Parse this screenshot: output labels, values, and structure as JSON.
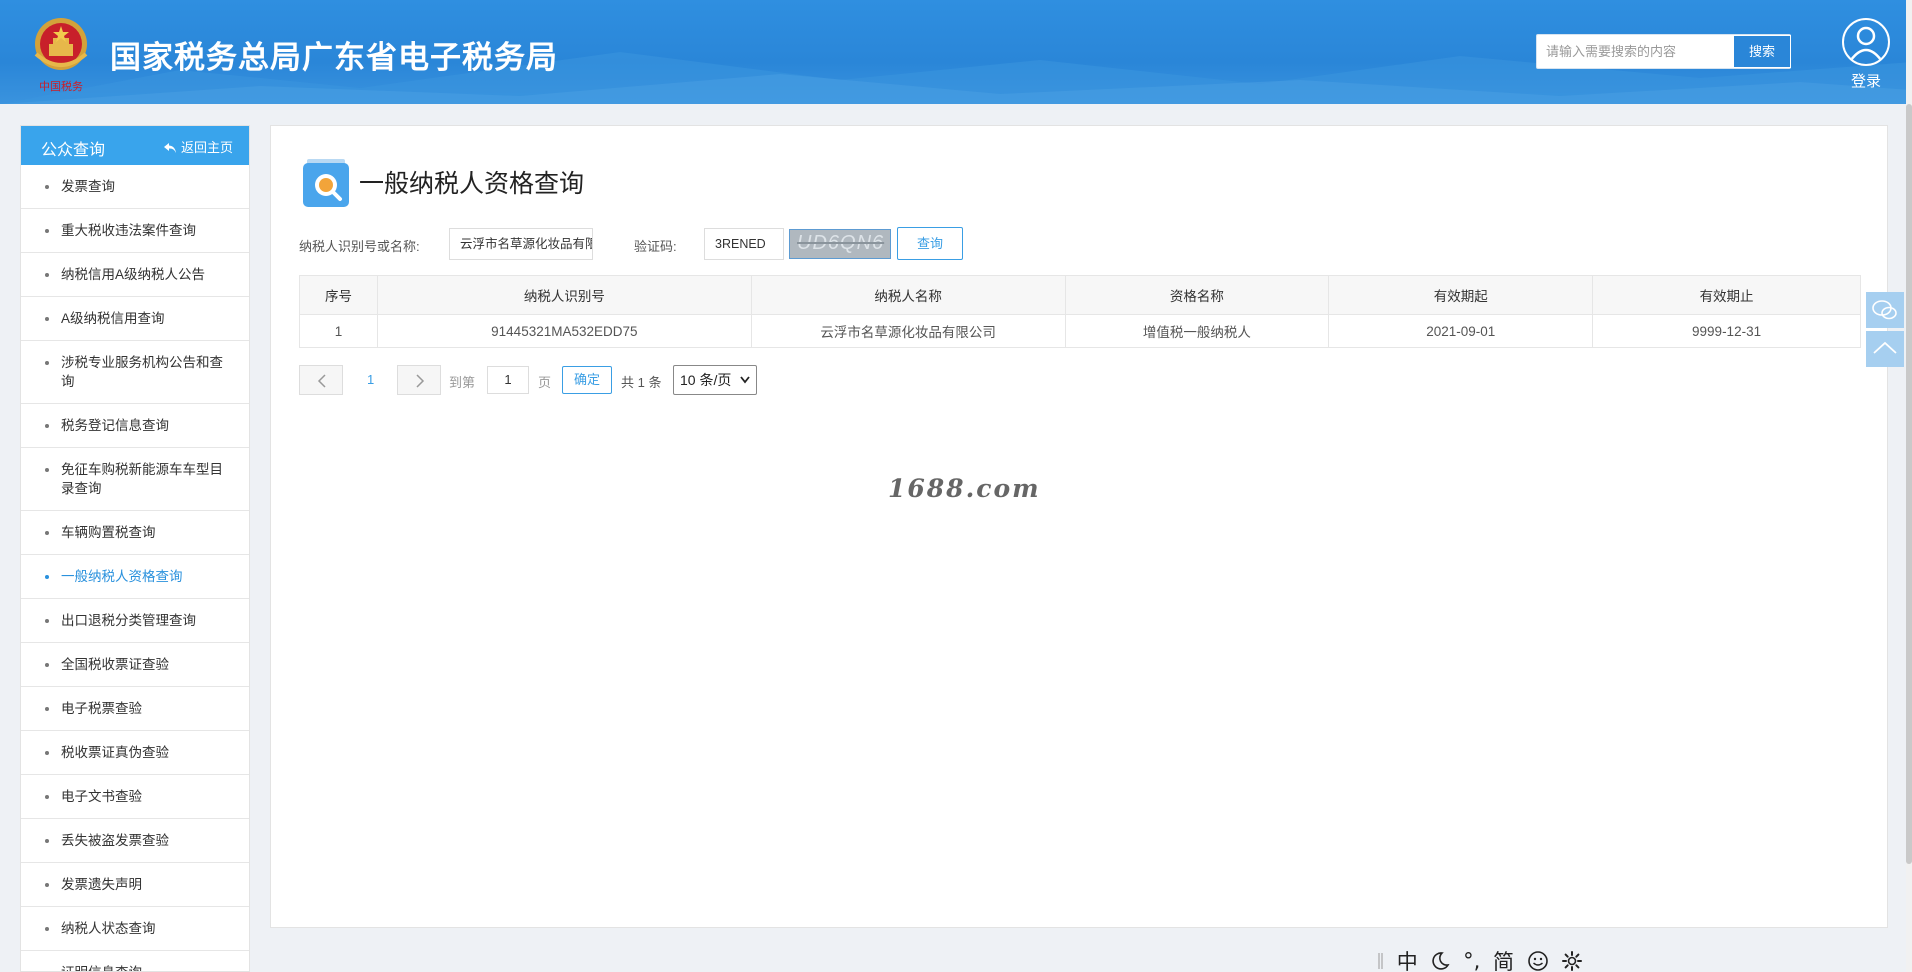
{
  "header": {
    "site_title": "国家税务总局广东省电子税务局",
    "emblem_text": "中国税务",
    "search_placeholder": "请输入需要搜索的内容",
    "search_button": "搜索",
    "login_label": "登录"
  },
  "sidebar": {
    "title": "公众查询",
    "back_label": "返回主页",
    "items": [
      {
        "label": "发票查询"
      },
      {
        "label": "重大税收违法案件查询"
      },
      {
        "label": "纳税信用A级纳税人公告"
      },
      {
        "label": "A级纳税信用查询"
      },
      {
        "label": "涉税专业服务机构公告和查询"
      },
      {
        "label": "税务登记信息查询"
      },
      {
        "label": "免征车购税新能源车车型目录查询"
      },
      {
        "label": "车辆购置税查询"
      },
      {
        "label": "一般纳税人资格查询",
        "active": true
      },
      {
        "label": "出口退税分类管理查询"
      },
      {
        "label": "全国税收票证查验"
      },
      {
        "label": "电子税票查验"
      },
      {
        "label": "税收票证真伪查验"
      },
      {
        "label": "电子文书查验"
      },
      {
        "label": "丢失被盗发票查验"
      },
      {
        "label": "发票遗失声明"
      },
      {
        "label": "纳税人状态查询"
      },
      {
        "label": "证明信息查询"
      }
    ]
  },
  "main": {
    "title": "一般纳税人资格查询",
    "taxpayer_label": "纳税人识别号或名称:",
    "taxpayer_value": "云浮市名草源化妆品有限",
    "captcha_label": "验证码:",
    "captcha_value": "3RENED",
    "captcha_image_text": "UD6QN6",
    "query_button": "查询",
    "table": {
      "columns": [
        "序号",
        "纳税人识别号",
        "纳税人名称",
        "资格名称",
        "有效期起",
        "有效期止"
      ],
      "rows": [
        [
          "1",
          "91445321MA532EDD75",
          "云浮市名草源化妆品有限公司",
          "增值税一般纳税人",
          "2021-09-01",
          "9999-12-31"
        ]
      ]
    },
    "pager": {
      "current_page": "1",
      "goto_label": "到第",
      "goto_value": "1",
      "page_unit": "页",
      "confirm": "确定",
      "total": "共 1 条",
      "page_size": "10 条/页"
    },
    "watermark": "1688.com"
  },
  "tools": {
    "lang": "中",
    "punct": "°,",
    "simp": "简"
  }
}
